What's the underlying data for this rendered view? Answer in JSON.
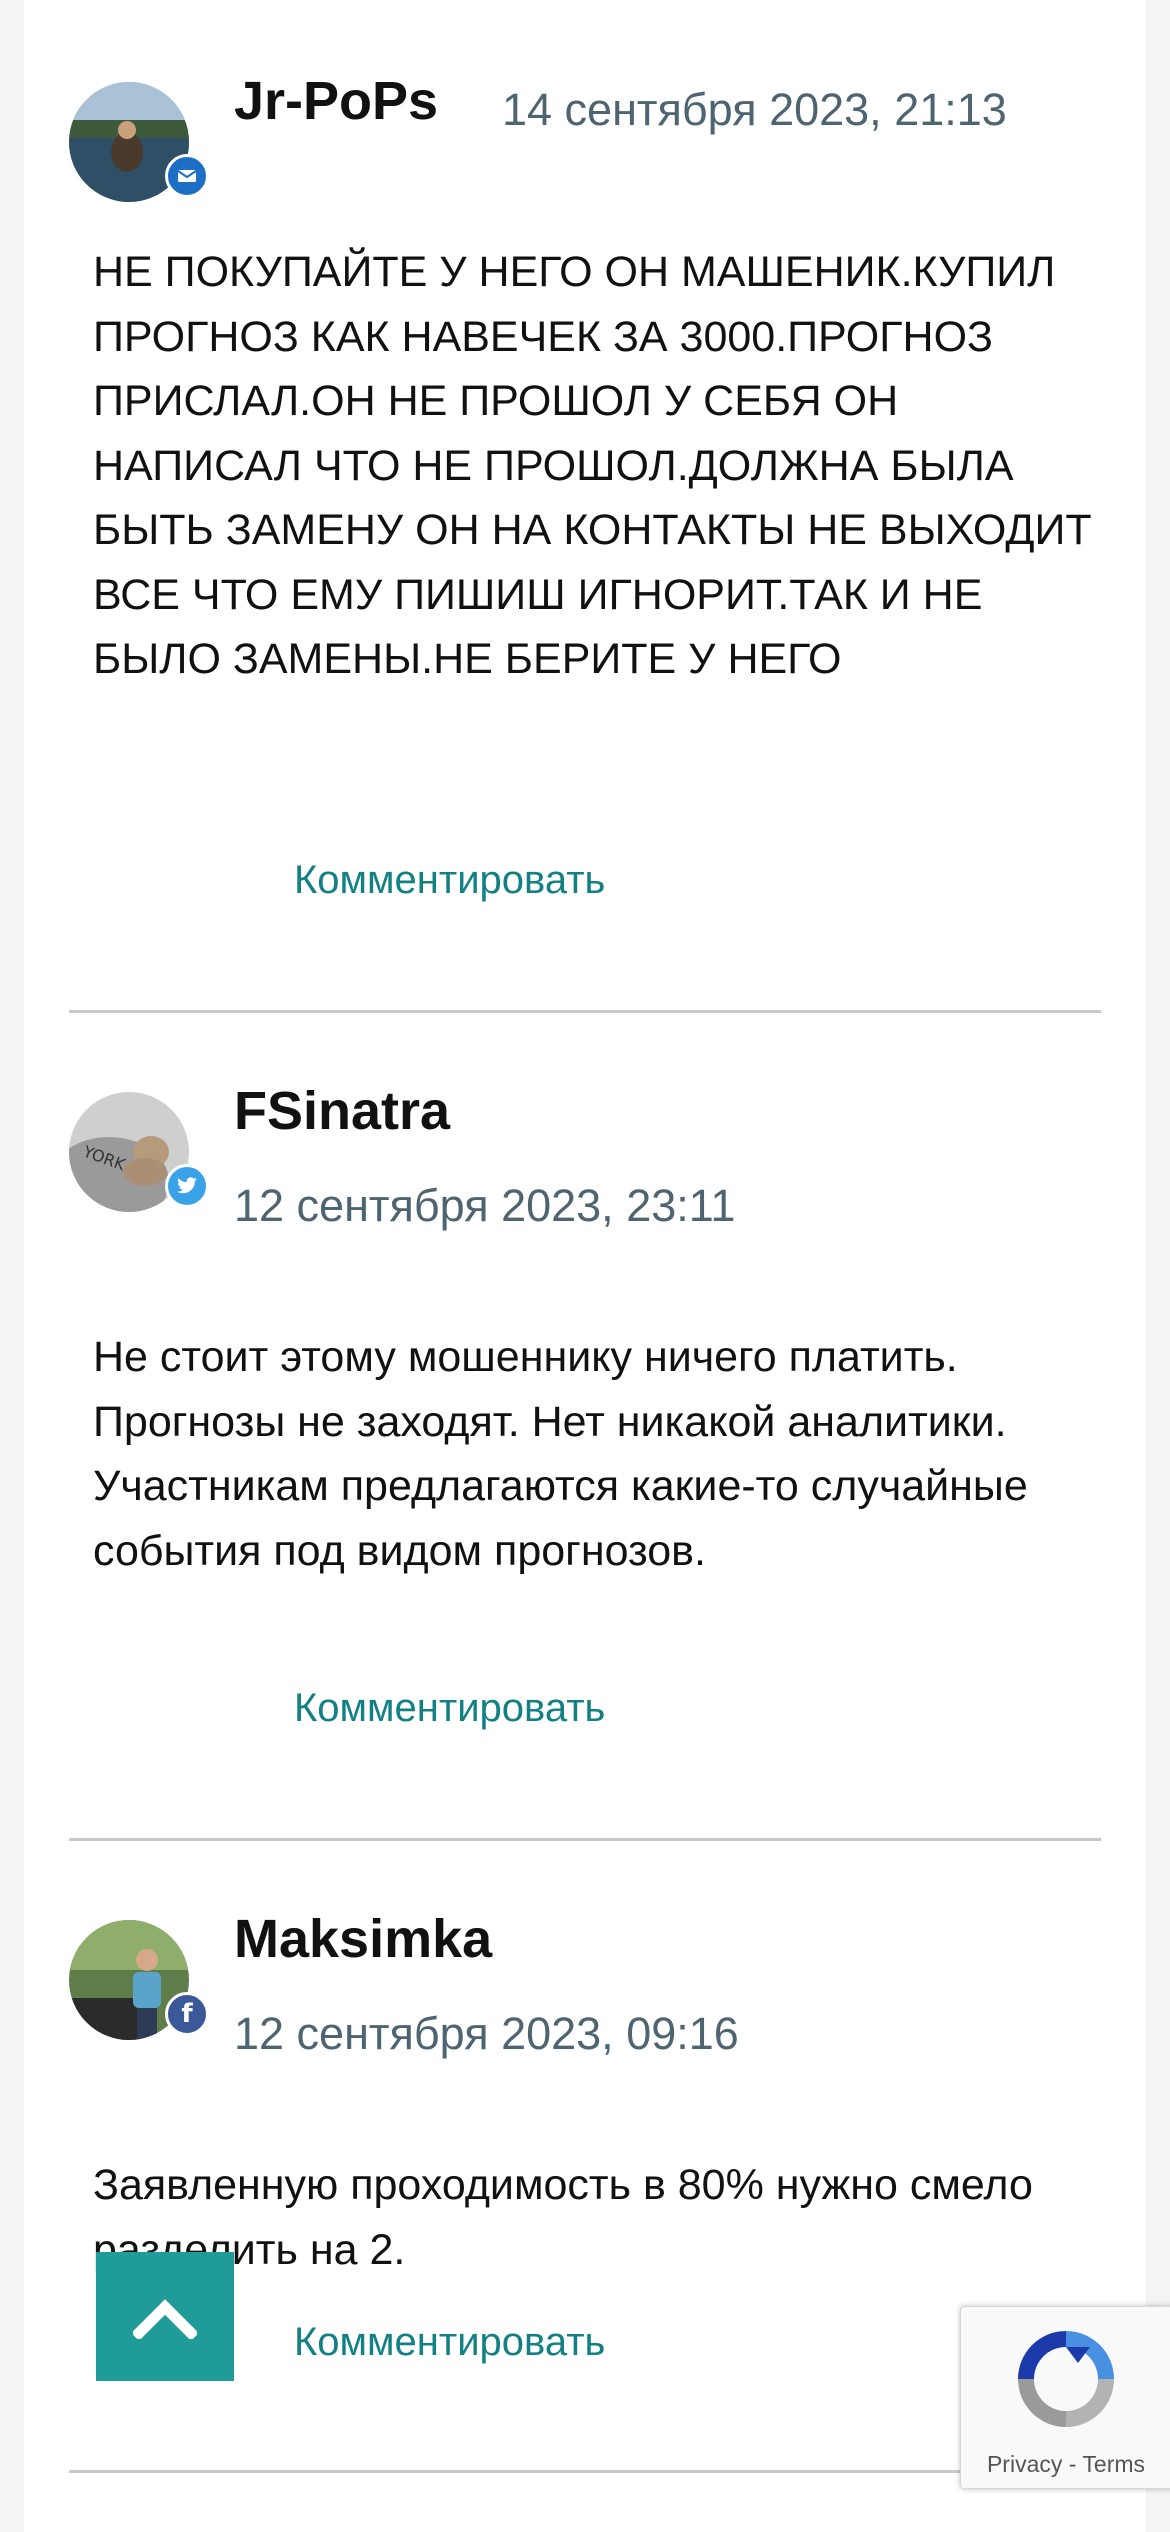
{
  "comments": [
    {
      "author": "Jr-PoPs",
      "date": "14 сентября 2023, 21:13",
      "text": "НЕ ПОКУПАЙТЕ У НЕГО ОН МАШЕНИК.КУПИЛ ПРОГНОЗ КАК НАВЕЧЕК ЗА 3000.ПРОГНОЗ ПРИСЛАЛ.ОН НЕ ПРОШОЛ У СЕБЯ ОН НАПИСАЛ ЧТО НЕ ПРОШОЛ.ДОЛЖНА БЫЛА БЫТЬ ЗАМЕНУ ОН НА КОНТАКТЫ НЕ ВЫХОДИТ ВСЕ ЧТО ЕМУ ПИШИШ ИГНОРИТ.ТАК И НЕ БЫЛО ЗАМЕНЫ.НЕ БЕРИТЕ У НЕГО",
      "reply_label": "Комментировать",
      "badge_icon": "mail-icon",
      "badge_color": "#1c6fc4"
    },
    {
      "author": "FSinatra",
      "date": "12 сентября 2023, 23:11",
      "text": "Не стоит этому мошеннику ничего платить. Прогнозы не заходят. Нет никакой аналитики. Участникам предлагаются какие-то случайные события под видом прогнозов.",
      "reply_label": "Комментировать",
      "badge_icon": "twitter-icon",
      "badge_color": "#3aa3e8"
    },
    {
      "author": "Maksimka",
      "date": "12 сентября 2023, 09:16",
      "text": "Заявленную проходимость в 80% нужно смело разделить на 2.",
      "reply_label": "Комментировать",
      "badge_icon": "facebook-icon",
      "badge_color": "#3b5998"
    }
  ],
  "recaptcha": {
    "privacy": "Privacy",
    "separator": "-",
    "terms": "Terms"
  },
  "colors": {
    "accent": "#138184",
    "scroll_button": "#1f9c99",
    "date": "#4e6470"
  }
}
